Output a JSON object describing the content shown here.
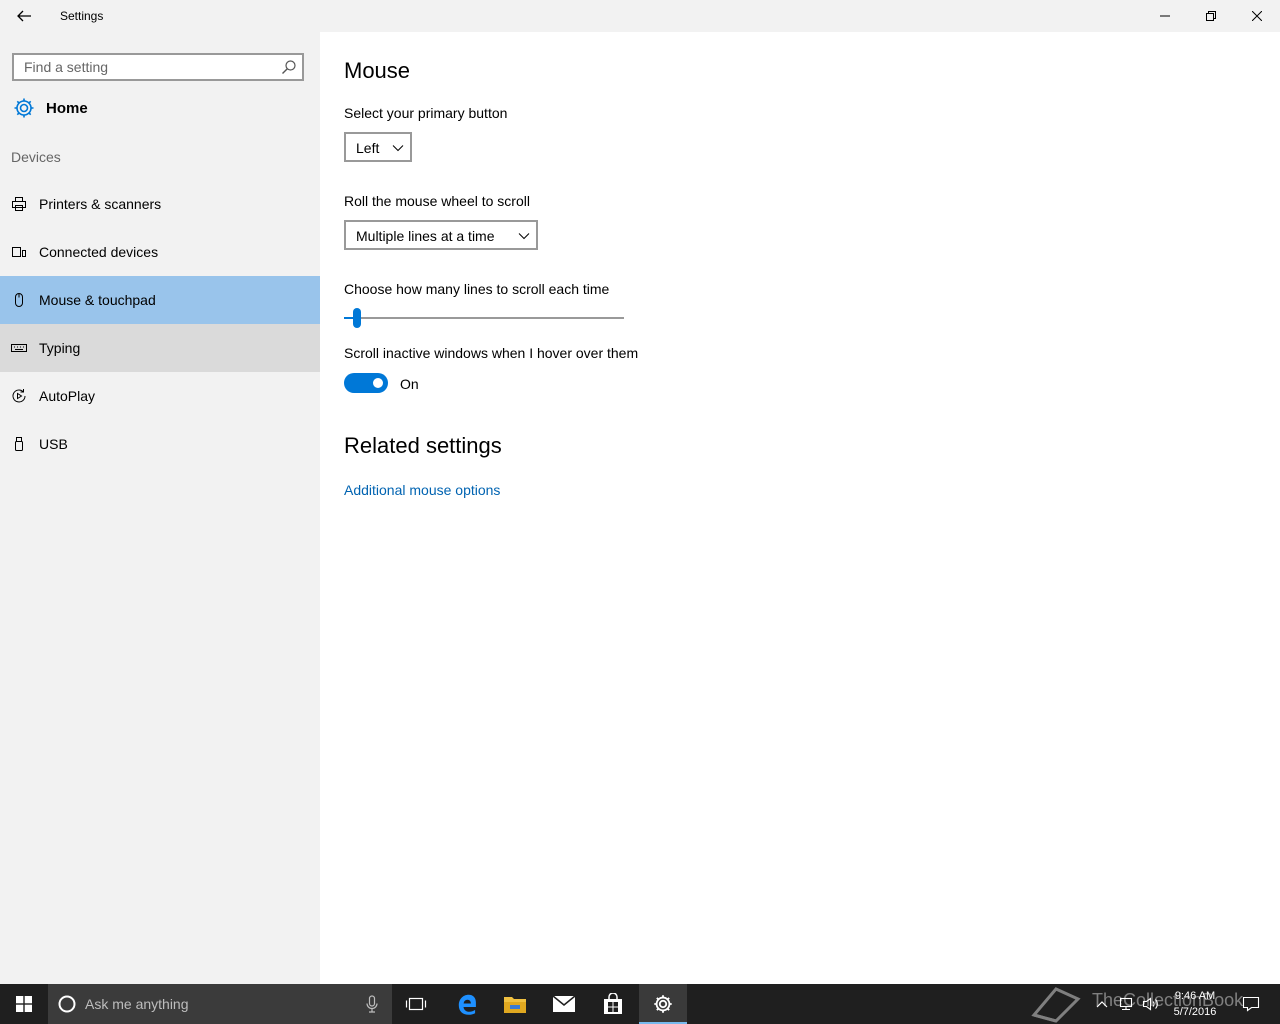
{
  "window": {
    "title": "Settings"
  },
  "sidebar": {
    "search_placeholder": "Find a setting",
    "home_label": "Home",
    "section_label": "Devices",
    "items": [
      {
        "label": "Printers & scanners",
        "icon": "printer-icon"
      },
      {
        "label": "Connected devices",
        "icon": "devices-icon"
      },
      {
        "label": "Mouse & touchpad",
        "icon": "mouse-icon",
        "selected": true
      },
      {
        "label": "Typing",
        "icon": "keyboard-icon"
      },
      {
        "label": "AutoPlay",
        "icon": "autoplay-icon"
      },
      {
        "label": "USB",
        "icon": "usb-icon"
      }
    ]
  },
  "main": {
    "title": "Mouse",
    "primary_button": {
      "label": "Select your primary button",
      "value": "Left"
    },
    "wheel_scroll": {
      "label": "Roll the mouse wheel to scroll",
      "value": "Multiple lines at a time"
    },
    "lines_slider": {
      "label": "Choose how many lines to scroll each time",
      "value_fraction": 0.03
    },
    "inactive_scroll": {
      "label": "Scroll inactive windows when I hover over them",
      "state": "On"
    },
    "related_title": "Related settings",
    "related_link": "Additional mouse options"
  },
  "taskbar": {
    "search_placeholder": "Ask me anything",
    "time": "9:46 AM",
    "date": "5/7/2016",
    "watermark": "TheCollectionBook"
  },
  "colors": {
    "accent": "#0078d7",
    "selected_nav": "#99c4eb",
    "link": "#0063b1",
    "sidebar_bg": "#f2f2f2",
    "taskbar_bg": "#1f1f1f"
  }
}
